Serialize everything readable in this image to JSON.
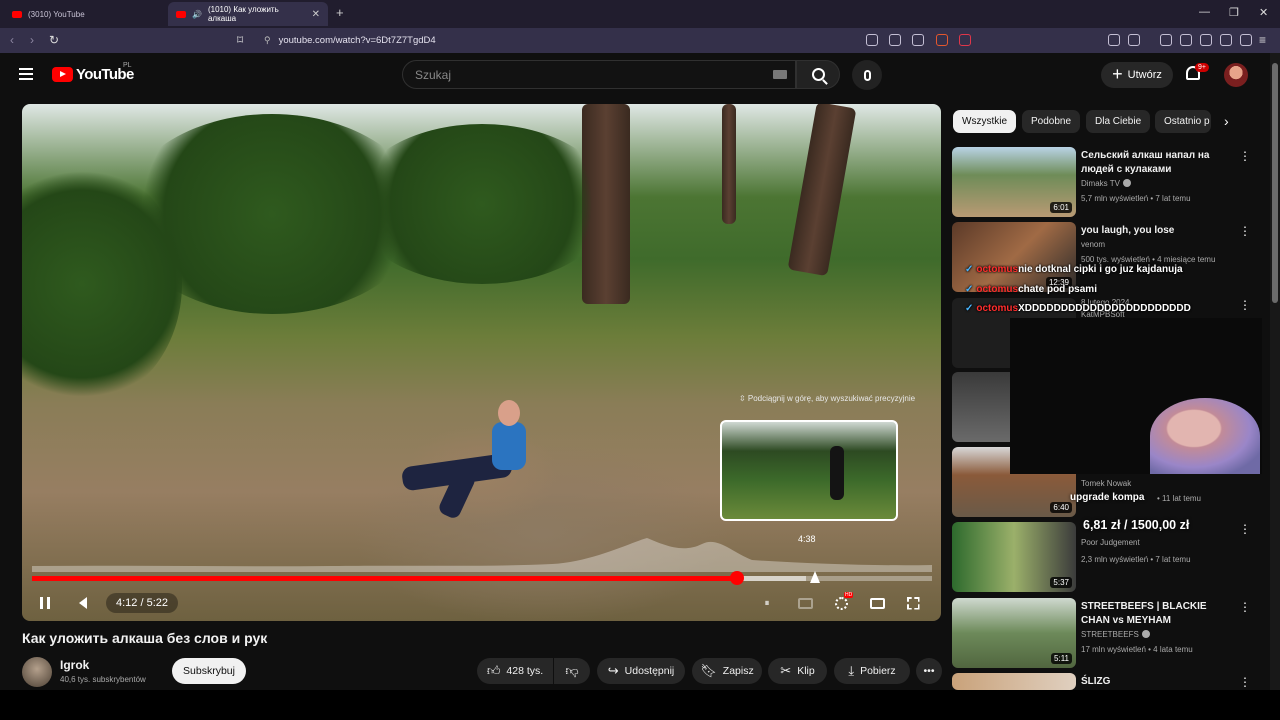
{
  "browser": {
    "tabs": [
      {
        "label": "(3010) YouTube"
      },
      {
        "label": "(1010) Как уложить алкаша"
      }
    ],
    "url": "youtube.com/watch?v=6Dt7Z7TgdD4"
  },
  "header": {
    "logo_text": "YouTube",
    "region": "PL",
    "search_placeholder": "Szukaj",
    "create_label": "Utwórz",
    "notifications_badge": "9+"
  },
  "player": {
    "seek_hint": "⇳ Podciągnij w górę, aby wyszukiwać precyzyjnie",
    "preview_time": "4:38",
    "time_display": "4:12 / 5:22",
    "progress_fraction": 0.783,
    "buffer_fraction": 0.86,
    "state": "playing"
  },
  "video": {
    "title": "Как уложить алкаша без слов и рук",
    "channel_name": "Igrok",
    "channel_subs": "40,6 tys. subskrybentów",
    "subscribe_label": "Subskrybuj",
    "like_count": "428 tys.",
    "share_label": "Udostępnij",
    "save_label": "Zapisz",
    "clip_label": "Klip",
    "download_label": "Pobierz"
  },
  "chips": [
    {
      "label": "Wszystkie"
    },
    {
      "label": "Podobne"
    },
    {
      "label": "Dla Ciebie"
    },
    {
      "label": "Ostatnio p"
    }
  ],
  "recommendations": [
    {
      "title": "Сельский алкаш напал на людей с кулаками",
      "channel": "Dimaks TV",
      "meta": "5,7 mln wyświetleń • 7 lat temu",
      "duration": "6:01"
    },
    {
      "title": "you laugh, you lose",
      "channel": "venom",
      "meta": "500 tys. wyświetleń • 4 miesiące temu",
      "duration": "12:39"
    },
    {
      "title": "",
      "channel": "KatMPBSoft",
      "meta": "8 lutego 2024",
      "duration": ""
    },
    {
      "title": "",
      "channel": "Tomek Nowak",
      "meta": "• 11 lat temu",
      "duration": "6:40"
    },
    {
      "title": "",
      "channel": "Poor Judgement",
      "meta": "2,3 mln wyświetleń • 7 lat temu",
      "duration": "5:37"
    },
    {
      "title": "STREETBEEFS | BLACKIE CHAN vs MEYHAM",
      "channel": "STREETBEEFS",
      "meta": "17 mln wyświetleń • 4 lata temu",
      "duration": "5:11"
    },
    {
      "title": "ŚLIZG",
      "channel": "",
      "meta": "",
      "duration": ""
    }
  ],
  "overlay": {
    "chat": [
      {
        "user": "octomus",
        "text": "nie dotknal cipki i go juz kajdanuja"
      },
      {
        "user": "octomus",
        "text": "chate pod psami"
      },
      {
        "user": "octomus",
        "text": "XDDDDDDDDDDDDDDDDDDDDDDD"
      }
    ],
    "donation_text": "upgrade kompa",
    "donation_amount": "6,81 zł / 1500,00 zł"
  }
}
